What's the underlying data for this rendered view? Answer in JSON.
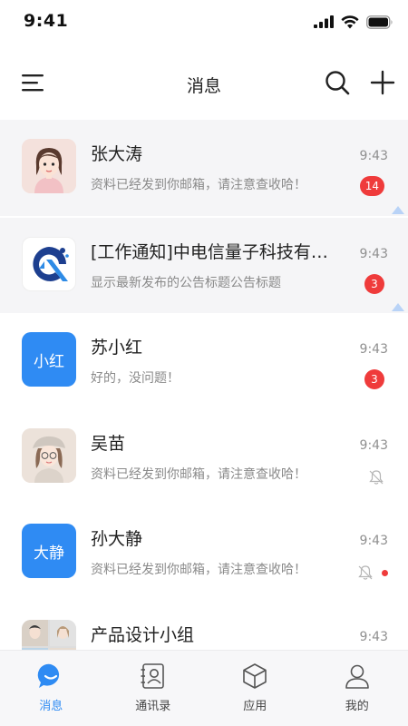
{
  "status_bar": {
    "time": "9:41"
  },
  "nav": {
    "title": "消息"
  },
  "conversations": [
    {
      "name": "张大涛",
      "message": "资料已经发到你邮箱，请注意查收哈！",
      "time": "9:43",
      "badge": "14",
      "pinned": true,
      "avatar_type": "photo-girl"
    },
    {
      "name": "[工作通知]中电信量子科技有限公司",
      "message": "显示最新发布的公告标题公告标题",
      "time": "9:43",
      "badge": "3",
      "pinned": true,
      "avatar_type": "logo"
    },
    {
      "name": "苏小红",
      "message": "好的，没问题！",
      "time": "9:43",
      "badge": "3",
      "avatar_text": "小红"
    },
    {
      "name": "吴苗",
      "message": "资料已经发到你邮箱，请注意查收哈！",
      "time": "9:43",
      "muted": true,
      "avatar_type": "photo-hat"
    },
    {
      "name": "孙大静",
      "message": "资料已经发到你邮箱，请注意查收哈！",
      "time": "9:43",
      "muted": true,
      "dot": true,
      "avatar_text": "大静"
    },
    {
      "name": "产品设计小组",
      "message": "",
      "time": "9:43",
      "avatar_type": "group"
    }
  ],
  "tabs": [
    {
      "label": "消息",
      "icon": "chat-bubble-icon",
      "active": true
    },
    {
      "label": "通讯录",
      "icon": "contacts-icon"
    },
    {
      "label": "应用",
      "icon": "cube-icon"
    },
    {
      "label": "我的",
      "icon": "profile-icon"
    }
  ],
  "colors": {
    "accent": "#2f8bf3",
    "badge": "#ef3b3b",
    "pinned_bg": "#f5f5f7"
  }
}
